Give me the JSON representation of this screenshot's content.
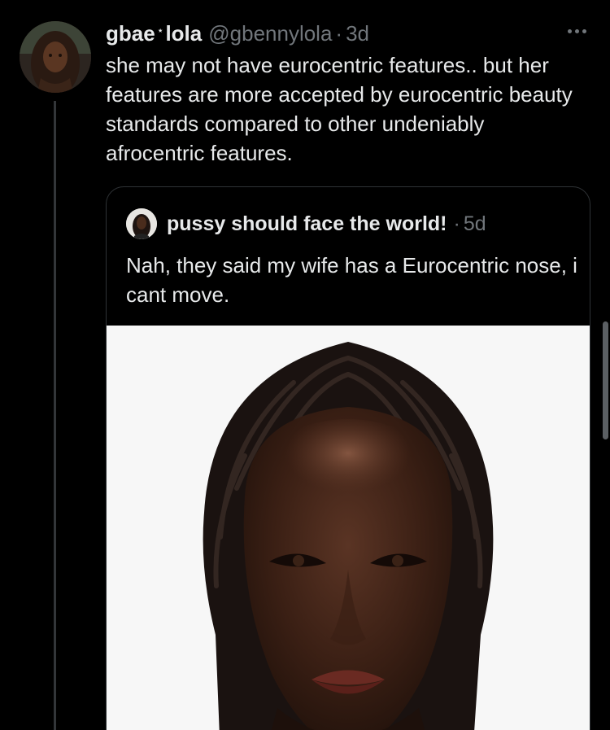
{
  "tweet": {
    "display_name_part1": "gbae",
    "star": "⋆",
    "display_name_part2": "lola",
    "handle": "@gbennylola",
    "separator": "·",
    "time": "3d",
    "text": "she may not have eurocentric features.. but her features are more accepted by eurocentric beauty standards compared to other undeniably afrocentric features.",
    "more_icon": "more-horizontal-icon"
  },
  "quote": {
    "display_name": "pussy should face the world!",
    "separator": "·",
    "time": "5d",
    "text": "Nah, they said my wife has a Eurocentric nose, i cant move."
  },
  "colors": {
    "background": "#000000",
    "primary_text": "#e7e9ea",
    "secondary_text": "#71767b",
    "border": "#2f3336"
  }
}
